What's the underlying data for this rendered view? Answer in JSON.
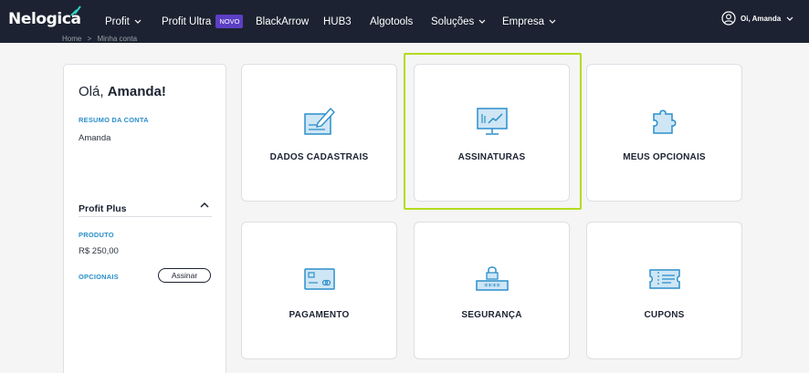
{
  "header": {
    "logo_text": "Nelogica",
    "nav": [
      {
        "label": "Profit",
        "has_dropdown": true
      },
      {
        "label": "Profit Ultra",
        "badge": "NOVO"
      },
      {
        "label": "BlackArrow"
      },
      {
        "label": "HUB3"
      },
      {
        "label": "Algotools"
      },
      {
        "label": "Soluções",
        "has_dropdown": true
      },
      {
        "label": "Empresa",
        "has_dropdown": true
      }
    ],
    "user_label": "Oi, Amanda",
    "colors": {
      "bar": "#1c2231",
      "badge": "#5b3fc4"
    }
  },
  "breadcrumb": [
    "Home",
    ">",
    "Minha conta"
  ],
  "sidebar": {
    "greeting_prefix": "Olá, ",
    "greeting_name": "Amanda!",
    "account_summary_label": "RESUMO DA CONTA",
    "account_name": "Amanda",
    "plan_name": "Profit Plus",
    "product_label": "PRODUTO",
    "product_price": "R$ 250,00",
    "optionals_label": "OPCIONAIS",
    "subscribe_button": "Assinar"
  },
  "cards": [
    {
      "label": "DADOS CADASTRAIS",
      "icon": "pencil-form-icon"
    },
    {
      "label": "ASSINATURAS",
      "icon": "monitor-chart-icon",
      "highlighted": true
    },
    {
      "label": "MEUS OPCIONAIS",
      "icon": "puzzle-piece-icon"
    },
    {
      "label": "PAGAMENTO",
      "icon": "credit-card-icon"
    },
    {
      "label": "SEGURANÇA",
      "icon": "lock-password-icon"
    },
    {
      "label": "CUPONS",
      "icon": "coupon-ticket-icon"
    }
  ],
  "accent_colors": {
    "icon_blue": "#2b8fcb",
    "icon_fill": "#cfe6f5",
    "highlight": "#b2dc1e"
  }
}
